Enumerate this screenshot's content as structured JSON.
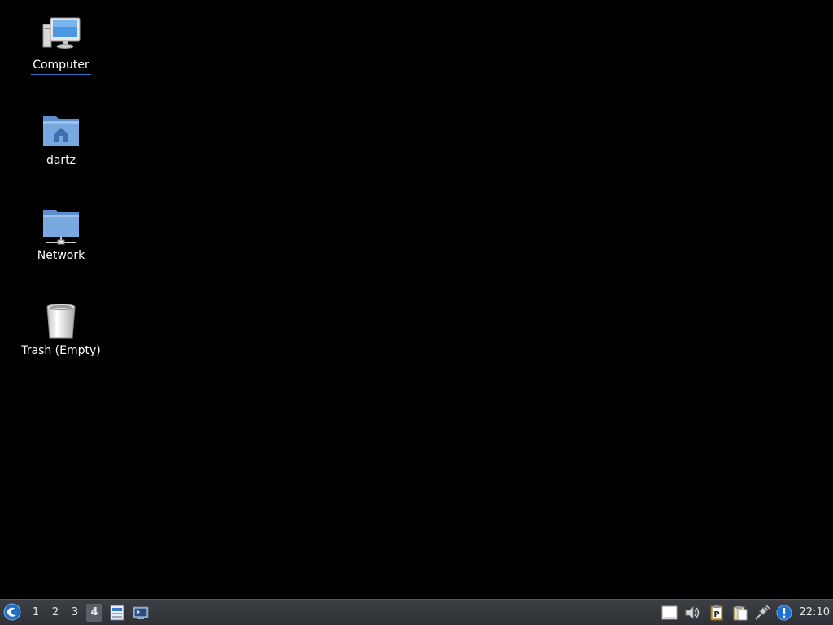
{
  "desktop": {
    "icons": [
      {
        "label": "Computer",
        "icon": "computer-icon"
      },
      {
        "label": "dartz",
        "icon": "home-folder-icon"
      },
      {
        "label": "Network",
        "icon": "network-folder-icon"
      },
      {
        "label": "Trash (Empty)",
        "icon": "trash-icon"
      }
    ]
  },
  "taskbar": {
    "start_icon": "menu-icon",
    "workspaces": [
      "1",
      "2",
      "3",
      "4"
    ],
    "active_workspace": "4",
    "launchers": [
      "file-manager-icon",
      "terminal-icon"
    ],
    "tray": [
      "notes-icon",
      "volume-icon",
      "clipboard-p-icon",
      "clipboard-icon",
      "network-plug-icon",
      "update-notification-icon"
    ],
    "clock": "22:10"
  }
}
